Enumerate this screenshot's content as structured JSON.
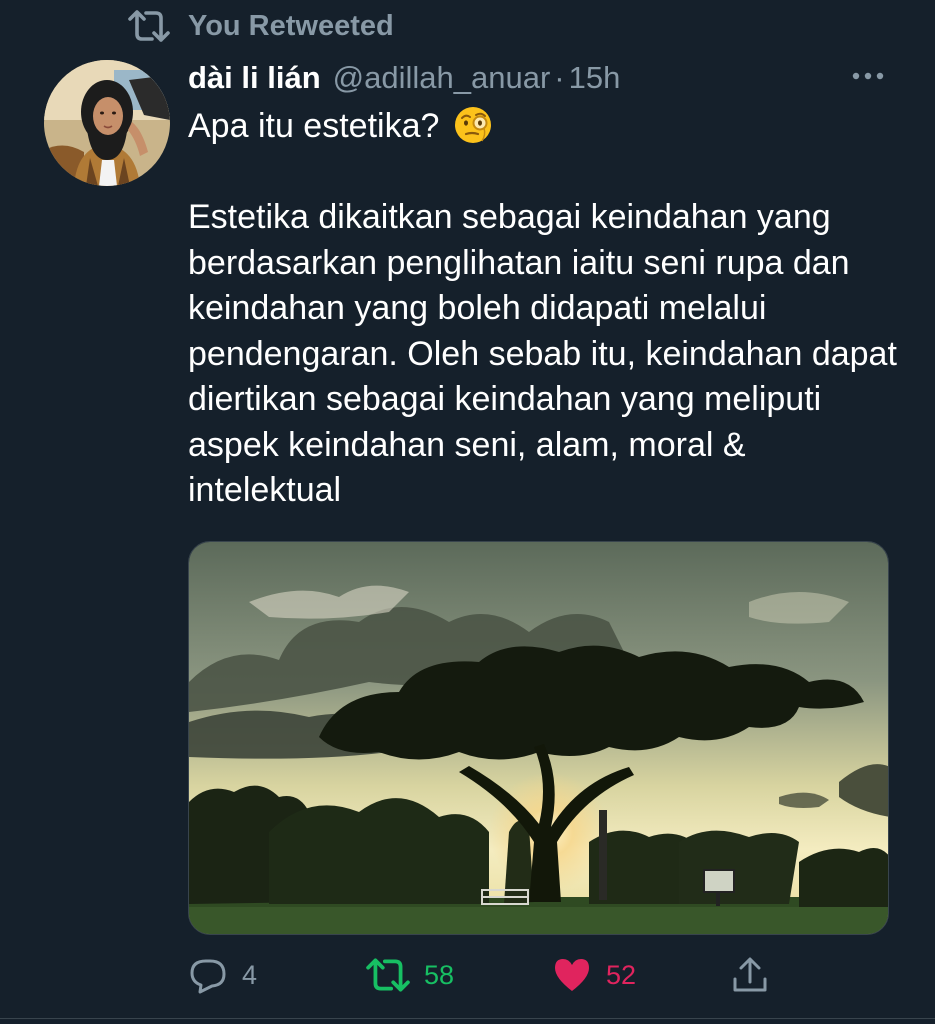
{
  "retweet_banner": {
    "text": "You Retweeted"
  },
  "author": {
    "display_name": "dài li lián",
    "handle": "@adillah_anuar",
    "separator": "·",
    "time": "15h"
  },
  "tweet": {
    "first_line": "Apa itu estetika?",
    "first_line_emoji": "face-with-monocle-emoji",
    "body": "Estetika dikaitkan sebagai keindahan yang berdasarkan penglihatan iaitu seni rupa dan keindahan yang boleh didapati melalui pendengaran. Oleh sebab itu, keindahan dapat diertikan sebagai keindahan yang meliputi aspek keindahan seni, alam, moral & intelektual"
  },
  "actions": {
    "reply_count": "4",
    "retweet_count": "58",
    "like_count": "52"
  },
  "colors": {
    "background": "#15202b",
    "secondary_text": "#8899a6",
    "retweet_green": "#17bf63",
    "like_pink": "#e0245e"
  },
  "icons": [
    "retweet-icon",
    "more-icon",
    "reply-icon",
    "retweet-action-icon",
    "heart-icon",
    "share-icon"
  ]
}
